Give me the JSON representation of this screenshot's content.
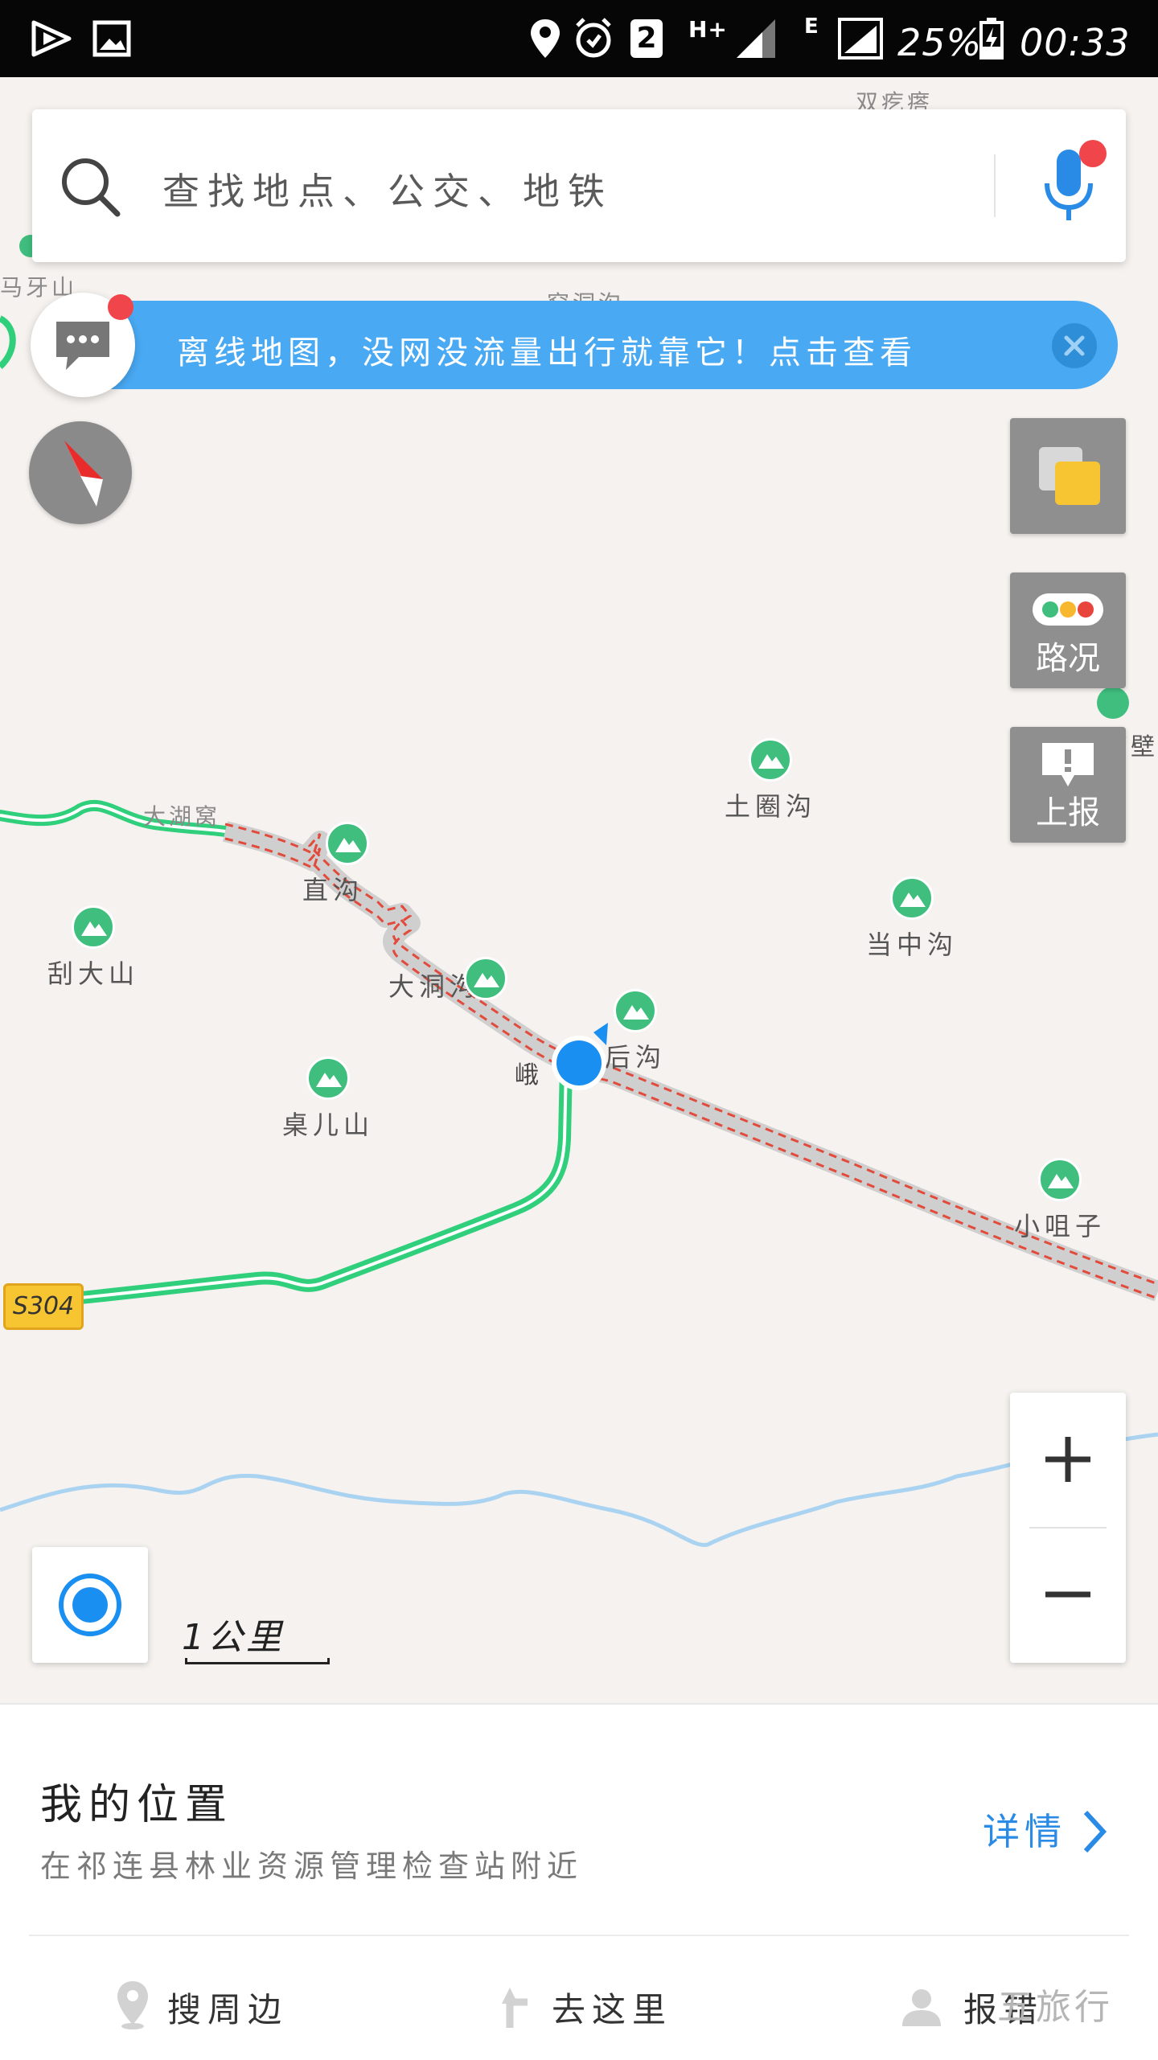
{
  "status_bar": {
    "sim_number": "2",
    "network_label": "H+",
    "edge_label": "E",
    "battery": "25%",
    "time": "00:33"
  },
  "search": {
    "placeholder": "查找地点、公交、地铁"
  },
  "banner": {
    "text": "离线地图，没网没流量出行就靠它！点击查看"
  },
  "tools": {
    "traffic_label": "路况",
    "report_label": "上报"
  },
  "zoom": {
    "in_label": "+",
    "out_label": "−"
  },
  "scale": {
    "label": "1公里"
  },
  "map": {
    "road_shield": "S304",
    "location_label": "峨",
    "places": [
      {
        "name": "土圈沟"
      },
      {
        "name": "直沟"
      },
      {
        "name": "刮大山"
      },
      {
        "name": "大洞沟"
      },
      {
        "name": "后沟"
      },
      {
        "name": "当中沟"
      },
      {
        "name": "桌儿山"
      },
      {
        "name": "小咀子"
      },
      {
        "name": "小石壁"
      }
    ],
    "faint_labels": [
      {
        "name": "大湖窝"
      },
      {
        "name": "马牙山"
      },
      {
        "name": "窑洞沟"
      },
      {
        "name": "双疙瘩"
      }
    ]
  },
  "sheet": {
    "title": "我的位置",
    "address": "在祁连县林业资源管理检查站附近",
    "detail": "详情",
    "actions": [
      {
        "label": "搜周边",
        "icon": "location-pin-icon"
      },
      {
        "label": "去这里",
        "icon": "turn-arrow-icon"
      },
      {
        "label": "报错",
        "icon": "person-icon"
      }
    ],
    "watermark": "五旅行"
  },
  "colors": {
    "accent_blue": "#49a9f3",
    "route_green": "#2fcf7c",
    "poi_green": "#3fbe7e",
    "alert_red": "#f0454a",
    "shield_yellow": "#f7c531"
  }
}
